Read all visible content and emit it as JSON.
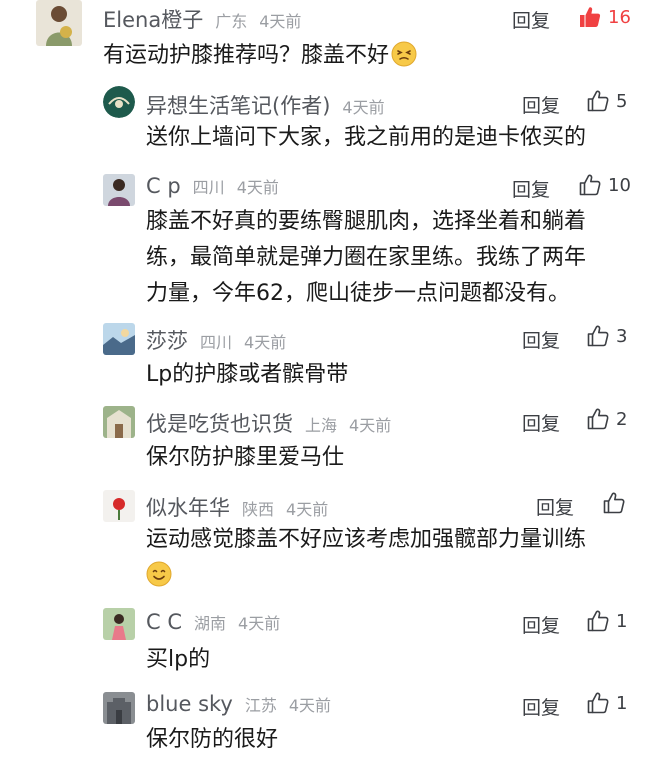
{
  "comments": {
    "c0": {
      "name": "Elena橙子",
      "location": "广东",
      "time": "4天前",
      "reply_label": "回复",
      "likes": "16",
      "liked": true,
      "text": "有运动护膝推荐吗？膝盖不好",
      "emoji": "grimace-face"
    },
    "c1": {
      "name": "异想生活笔记(作者)",
      "location": "",
      "time": "4天前",
      "reply_label": "回复",
      "likes": "5",
      "text": "送你上墙问下大家，我之前用的是迪卡侬买的"
    },
    "c2": {
      "name": "C p",
      "location": "四川",
      "time": "4天前",
      "reply_label": "回复",
      "likes": "10",
      "text_lines": [
        "膝盖不好真的要练臀腿肌肉，选择坐着和躺着",
        "练，最简单就是弹力圈在家里练。我练了两年",
        "力量，今年62，爬山徒步一点问题都没有。"
      ]
    },
    "c3": {
      "name": "莎莎",
      "location": "四川",
      "time": "4天前",
      "reply_label": "回复",
      "likes": "3",
      "text": "Lp的护膝或者髌骨带"
    },
    "c4": {
      "name": "伐是吃货也识货",
      "location": "上海",
      "time": "4天前",
      "reply_label": "回复",
      "likes": "2",
      "text": "保尔防护膝里爱马仕"
    },
    "c5": {
      "name": "似水年华",
      "location": "陕西",
      "time": "4天前",
      "reply_label": "回复",
      "likes": "",
      "text": "运动感觉膝盖不好应该考虑加强髋部力量训练",
      "emoji": "smile-face"
    },
    "c6": {
      "name": "C C",
      "location": "湖南",
      "time": "4天前",
      "reply_label": "回复",
      "likes": "1",
      "text": "买lp的"
    },
    "c7": {
      "name": "blue sky",
      "location": "江苏",
      "time": "4天前",
      "reply_label": "回复",
      "likes": "1",
      "text": "保尔防的很好"
    }
  },
  "colors": {
    "like_active": "#f04142",
    "text_primary": "#1a1a1a",
    "text_secondary": "#55585e",
    "text_muted": "#9b9ea3"
  }
}
